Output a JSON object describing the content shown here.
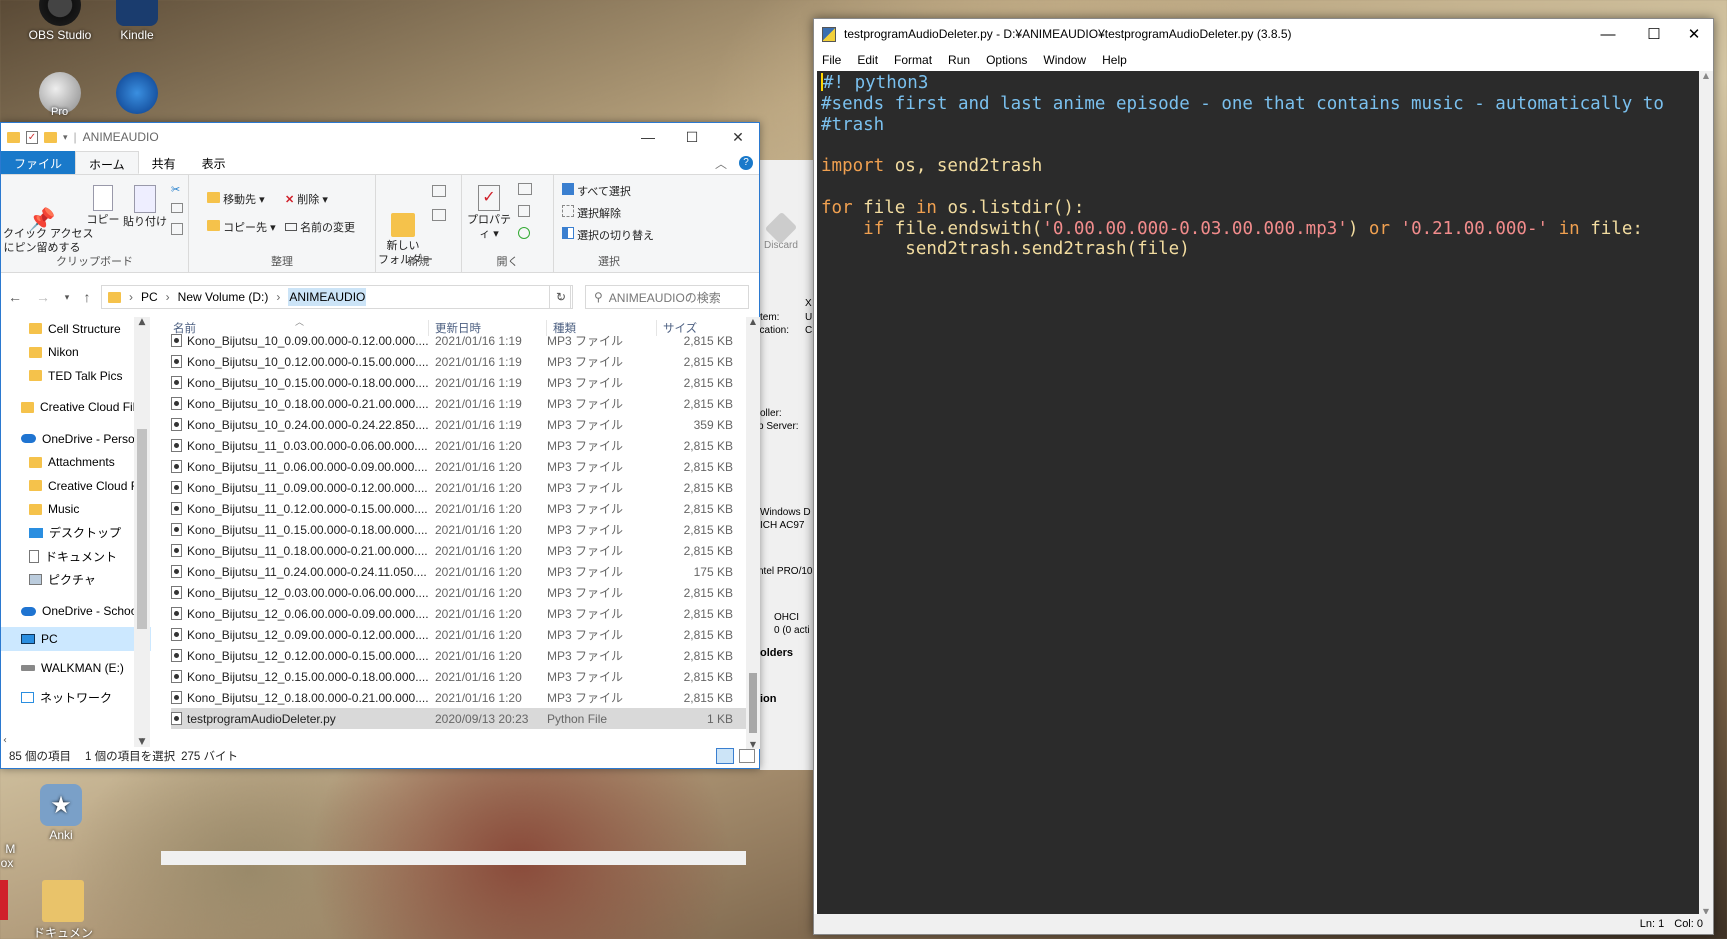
{
  "desktop": {
    "icons": [
      {
        "label": "OBS Studio"
      },
      {
        "label": "Kindle"
      },
      {
        "label": "Pro"
      },
      {
        "label": "Anki"
      },
      {
        "label": "M\nox"
      },
      {
        "label": "ドキュメント - シ"
      }
    ]
  },
  "explorer": {
    "title": "ANIMEAUDIO",
    "tabs": [
      "ファイル",
      "ホーム",
      "共有",
      "表示"
    ],
    "ribbon": {
      "clipboard": {
        "pin": "クイック アクセス\nにピン留めする",
        "copy": "コピー",
        "paste": "貼り付け",
        "label": "クリップボード"
      },
      "organize": {
        "move": "移動先",
        "delete": "削除",
        "copyto": "コピー先",
        "rename": "名前の変更",
        "label": "整理"
      },
      "new": {
        "folder": "新しい\nフォルダー",
        "label": "新規"
      },
      "open": {
        "properties": "プロパティ",
        "label": "開く"
      },
      "select": {
        "all": "すべて選択",
        "none": "選択解除",
        "invert": "選択の切り替え",
        "label": "選択"
      }
    },
    "address": {
      "pc": "PC",
      "volume": "New Volume (D:)",
      "folder": "ANIMEAUDIO"
    },
    "search_placeholder": "ANIMEAUDIOの検索",
    "nav": [
      {
        "label": "Cell Structure",
        "icon": "folder"
      },
      {
        "label": "Nikon",
        "icon": "folder"
      },
      {
        "label": "TED Talk Pics",
        "icon": "folder"
      },
      {
        "label": "Creative Cloud File",
        "icon": "cc-folder"
      },
      {
        "label": "OneDrive - Person",
        "icon": "cloud"
      },
      {
        "label": "Attachments",
        "icon": "folder"
      },
      {
        "label": "Creative Cloud F",
        "icon": "folder"
      },
      {
        "label": "Music",
        "icon": "folder"
      },
      {
        "label": "デスクトップ",
        "icon": "desktop"
      },
      {
        "label": "ドキュメント",
        "icon": "document"
      },
      {
        "label": "ピクチャ",
        "icon": "picture"
      },
      {
        "label": "OneDrive - Schoo",
        "icon": "cloud"
      },
      {
        "label": "PC",
        "icon": "pc"
      },
      {
        "label": "WALKMAN (E:)",
        "icon": "drive"
      },
      {
        "label": "ネットワーク",
        "icon": "network"
      }
    ],
    "columns": {
      "name": "名前",
      "date": "更新日時",
      "type": "種類",
      "size": "サイズ"
    },
    "files": [
      {
        "name": "Kono_Bijutsu_10_0.09.00.000-0.12.00.000....",
        "date": "2021/01/16 1:19",
        "type": "MP3 ファイル",
        "size": "2,815 KB"
      },
      {
        "name": "Kono_Bijutsu_10_0.12.00.000-0.15.00.000....",
        "date": "2021/01/16 1:19",
        "type": "MP3 ファイル",
        "size": "2,815 KB"
      },
      {
        "name": "Kono_Bijutsu_10_0.15.00.000-0.18.00.000....",
        "date": "2021/01/16 1:19",
        "type": "MP3 ファイル",
        "size": "2,815 KB"
      },
      {
        "name": "Kono_Bijutsu_10_0.18.00.000-0.21.00.000....",
        "date": "2021/01/16 1:19",
        "type": "MP3 ファイル",
        "size": "2,815 KB"
      },
      {
        "name": "Kono_Bijutsu_10_0.24.00.000-0.24.22.850....",
        "date": "2021/01/16 1:19",
        "type": "MP3 ファイル",
        "size": "359 KB"
      },
      {
        "name": "Kono_Bijutsu_11_0.03.00.000-0.06.00.000....",
        "date": "2021/01/16 1:20",
        "type": "MP3 ファイル",
        "size": "2,815 KB"
      },
      {
        "name": "Kono_Bijutsu_11_0.06.00.000-0.09.00.000....",
        "date": "2021/01/16 1:20",
        "type": "MP3 ファイル",
        "size": "2,815 KB"
      },
      {
        "name": "Kono_Bijutsu_11_0.09.00.000-0.12.00.000....",
        "date": "2021/01/16 1:20",
        "type": "MP3 ファイル",
        "size": "2,815 KB"
      },
      {
        "name": "Kono_Bijutsu_11_0.12.00.000-0.15.00.000....",
        "date": "2021/01/16 1:20",
        "type": "MP3 ファイル",
        "size": "2,815 KB"
      },
      {
        "name": "Kono_Bijutsu_11_0.15.00.000-0.18.00.000....",
        "date": "2021/01/16 1:20",
        "type": "MP3 ファイル",
        "size": "2,815 KB"
      },
      {
        "name": "Kono_Bijutsu_11_0.18.00.000-0.21.00.000....",
        "date": "2021/01/16 1:20",
        "type": "MP3 ファイル",
        "size": "2,815 KB"
      },
      {
        "name": "Kono_Bijutsu_11_0.24.00.000-0.24.11.050....",
        "date": "2021/01/16 1:20",
        "type": "MP3 ファイル",
        "size": "175 KB"
      },
      {
        "name": "Kono_Bijutsu_12_0.03.00.000-0.06.00.000....",
        "date": "2021/01/16 1:20",
        "type": "MP3 ファイル",
        "size": "2,815 KB"
      },
      {
        "name": "Kono_Bijutsu_12_0.06.00.000-0.09.00.000....",
        "date": "2021/01/16 1:20",
        "type": "MP3 ファイル",
        "size": "2,815 KB"
      },
      {
        "name": "Kono_Bijutsu_12_0.09.00.000-0.12.00.000....",
        "date": "2021/01/16 1:20",
        "type": "MP3 ファイル",
        "size": "2,815 KB"
      },
      {
        "name": "Kono_Bijutsu_12_0.12.00.000-0.15.00.000....",
        "date": "2021/01/16 1:20",
        "type": "MP3 ファイル",
        "size": "2,815 KB"
      },
      {
        "name": "Kono_Bijutsu_12_0.15.00.000-0.18.00.000....",
        "date": "2021/01/16 1:20",
        "type": "MP3 ファイル",
        "size": "2,815 KB"
      },
      {
        "name": "Kono_Bijutsu_12_0.18.00.000-0.21.00.000....",
        "date": "2021/01/16 1:20",
        "type": "MP3 ファイル",
        "size": "2,815 KB"
      },
      {
        "name": "testprogramAudioDeleter.py",
        "date": "2020/09/13 20:23",
        "type": "Python File",
        "size": "1 KB",
        "selected": true
      }
    ],
    "status": {
      "count": "85 個の項目",
      "selected": "1 個の項目を選択",
      "bytes": "275 バイト"
    }
  },
  "behind_window": {
    "texts": [
      "Discard",
      "X",
      "tem:",
      "U",
      "ocation:",
      "C",
      "oller:",
      "p Server:",
      "Windows D",
      "ICH AC97",
      "ntel PRO/10",
      "OHCI",
      "0 (0 acti",
      "olders",
      "ion"
    ]
  },
  "idle": {
    "title": "testprogramAudioDeleter.py - D:¥ANIMEAUDIO¥testprogramAudioDeleter.py (3.8.5)",
    "menu": [
      "File",
      "Edit",
      "Format",
      "Run",
      "Options",
      "Window",
      "Help"
    ],
    "code": {
      "l1": "#! python3",
      "l2": "#sends first and last anime episode - one that contains music - automatically to",
      "l3": "#trash",
      "l5_kw": "import",
      "l5_rest": " os, send2trash",
      "l7_for": "for",
      "l7_a": " file ",
      "l7_in": "in",
      "l7_b": " os.listdir():",
      "l8_indent": "    ",
      "l8_if": "if",
      "l8_a": " file.endswith(",
      "l8_s1": "'0.00.00.000-0.03.00.000.mp3'",
      "l8_b": ") ",
      "l8_or": "or",
      "l8_c": " ",
      "l8_s2": "'0.21.00.000-'",
      "l8_d": " ",
      "l8_in": "in",
      "l8_e": " file:",
      "l9": "        send2trash.send2trash(file)"
    },
    "status": {
      "ln": "Ln: 1",
      "col": "Col: 0"
    }
  },
  "colors": {
    "keyword": "#f0a050",
    "comment": "#7ac0ee",
    "string": "#f28c8c",
    "editor_bg": "#2b2b2b",
    "accent": "#1979ca"
  }
}
